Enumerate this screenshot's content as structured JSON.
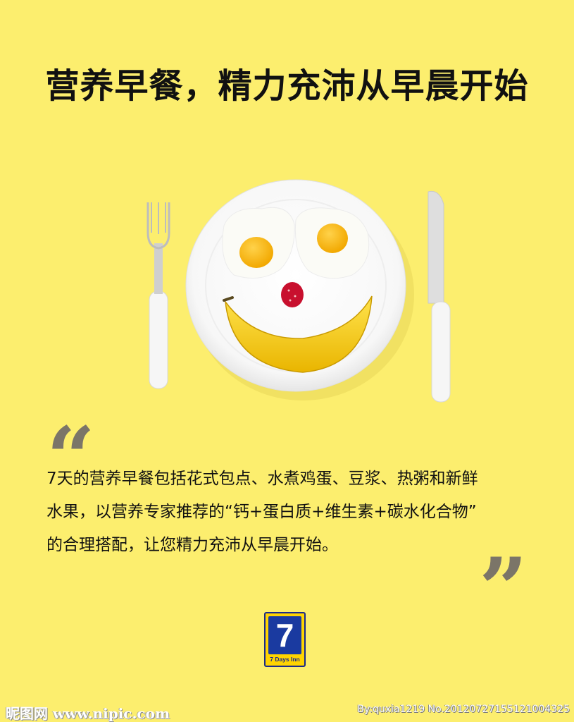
{
  "headline": "营养早餐，精力充沛从早晨开始",
  "quote_open": "“",
  "quote_close": "”",
  "body_lines": [
    "7天的营养早餐包括花式包点、水煮鸡蛋、豆浆、热粥和新鲜",
    "水果，以营养专家推荐的“钙+蛋白质+维生素+碳水化合物”",
    "的合理搭配，让您精力充沛从早晨开始。"
  ],
  "logo": {
    "number": "7",
    "name": "7 Days Inn"
  },
  "watermark": {
    "left": "昵图网 www.nipic.com",
    "right": "By:quxia1219  No.20120727155121004325"
  },
  "colors": {
    "background": "#fcee6e",
    "quote_marks": "#7b7568",
    "logo_blue": "#1a3aa0",
    "logo_yellow": "#ffd400"
  },
  "illustration": {
    "items": [
      "fork-icon",
      "plate",
      "fried-egg-left",
      "fried-egg-right",
      "strawberry-nose",
      "banana-smile",
      "knife-icon"
    ]
  }
}
